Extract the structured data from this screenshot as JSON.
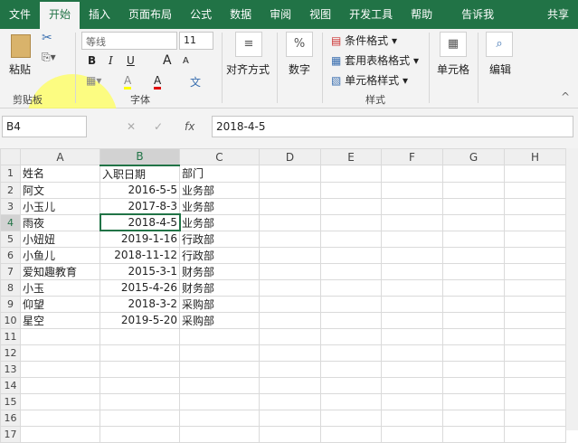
{
  "tabs": [
    "文件",
    "开始",
    "插入",
    "页面布局",
    "公式",
    "数据",
    "审阅",
    "视图",
    "开发工具",
    "帮助",
    "告诉我",
    "共享"
  ],
  "ribbon": {
    "clipboard": {
      "paste": "粘贴",
      "group": "剪贴板"
    },
    "font": {
      "name": "等线",
      "size": "11",
      "bold": "B",
      "italic": "I",
      "underline": "U",
      "grow": "A",
      "shrink": "A",
      "fill": "A",
      "color": "A",
      "wen": "文",
      "group": "字体"
    },
    "align": {
      "label": "对齐方式",
      "icon": "≡"
    },
    "number": {
      "label": "数字",
      "icon": "%"
    },
    "styles": {
      "cond": "条件格式",
      "table": "套用表格格式",
      "cell": "单元格样式",
      "group": "样式"
    },
    "cells": {
      "label": "单元格"
    },
    "edit": {
      "label": "编辑"
    }
  },
  "formula_bar": {
    "name_box": "B4",
    "fx": "fx",
    "value": "2018-4-5"
  },
  "columns": [
    "A",
    "B",
    "C",
    "D",
    "E",
    "F",
    "G",
    "H"
  ],
  "rows": [
    [
      "姓名",
      "入职日期",
      "部门"
    ],
    [
      "阿文",
      "2016-5-5",
      "业务部"
    ],
    [
      "小玉儿",
      "2017-8-3",
      "业务部"
    ],
    [
      "雨夜",
      "2018-4-5",
      "业务部"
    ],
    [
      "小妞妞",
      "2019-1-16",
      "行政部"
    ],
    [
      "小鱼儿",
      "2018-11-12",
      "行政部"
    ],
    [
      "爱知趣教育",
      "2015-3-1",
      "财务部"
    ],
    [
      "小玉",
      "2015-4-26",
      "财务部"
    ],
    [
      "仰望",
      "2018-3-2",
      "采购部"
    ],
    [
      "星空",
      "2019-5-20",
      "采购部"
    ],
    [
      "",
      "",
      ""
    ],
    [
      "",
      "",
      ""
    ],
    [
      "",
      "",
      ""
    ],
    [
      "",
      "",
      ""
    ],
    [
      "",
      "",
      ""
    ],
    [
      "",
      "",
      ""
    ],
    [
      "",
      "",
      ""
    ]
  ],
  "accent": "#217346"
}
